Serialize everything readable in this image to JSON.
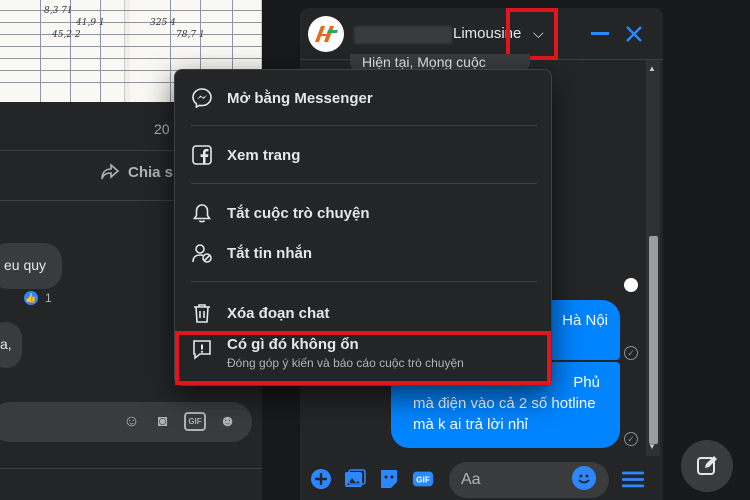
{
  "feed": {
    "photo_time": "20",
    "share_label": "Chia s",
    "comment_1": "eu quy",
    "reaction_count": "1",
    "comment_2": "a,"
  },
  "chat": {
    "name": "Limousine",
    "top_message": "Hiện tại, Mọng cuộc",
    "msg_1": "Hà Nội",
    "msg_2_lines": [
      "Phủ",
      "mà điện vào cả 2 số hotline",
      "mà k ai trả lời nhỉ"
    ],
    "input_placeholder": "Aa"
  },
  "menu": {
    "items": [
      {
        "label": "Mở bằng Messenger",
        "icon": "messenger-icon"
      },
      {
        "label": "Xem trang",
        "icon": "facebook-icon"
      },
      {
        "label": "Tắt cuộc trò chuyện",
        "icon": "bell-icon"
      },
      {
        "label": "Tắt tin nhắn",
        "icon": "person-block-icon"
      },
      {
        "label": "Xóa đoạn chat",
        "icon": "trash-icon"
      }
    ],
    "report": {
      "title_pre": "Có gì ",
      "title_bold": "đó không ổn",
      "subtitle": "Đóng góp ý kiến và báo cáo cuộc trò chuyện"
    }
  },
  "colors": {
    "accent": "#2d88ff",
    "bubble": "#0084ff",
    "highlight": "#e0161e",
    "surface": "#242526"
  }
}
